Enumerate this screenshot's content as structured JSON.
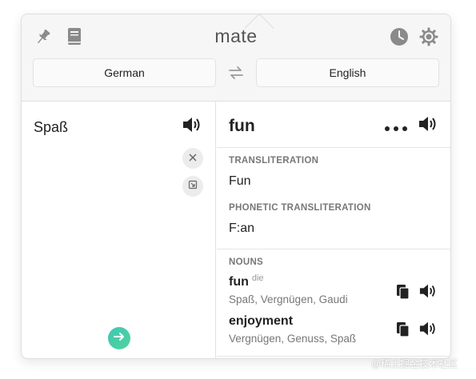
{
  "header": {
    "title": "mate",
    "source_language": "German",
    "target_language": "English",
    "icons": [
      "pin-icon",
      "book-icon",
      "clock-icon",
      "gear-icon",
      "swap-icon"
    ]
  },
  "source": {
    "text": "Spaß"
  },
  "translation": {
    "word": "fun",
    "transliteration_label": "TRANSLITERATION",
    "transliteration_value": "Fun",
    "phonetic_label": "PHONETIC TRANSLITERATION",
    "phonetic_value": "F:an",
    "nouns_label": "NOUNS",
    "nouns": [
      {
        "word": "fun",
        "article": "die",
        "synonyms": "Spaß, Vergnügen, Gaudi"
      },
      {
        "word": "enjoyment",
        "article": "",
        "synonyms": "Vergnügen, Genuss, Spaß"
      }
    ]
  },
  "watermark": "@稀土掘金技术社区",
  "colors": {
    "accent_start": "#3fc8b3",
    "accent_end": "#4fd39c",
    "icon_gray": "#8a8a8a"
  }
}
